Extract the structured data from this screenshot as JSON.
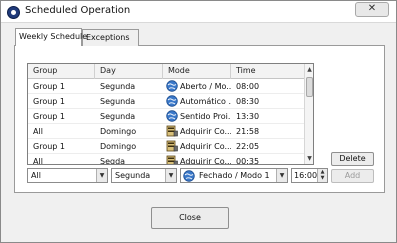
{
  "window": {
    "title": "Scheduled Operation",
    "close_glyph": "✕"
  },
  "tabs": [
    {
      "label": "Weekly Schedule",
      "active": true
    },
    {
      "label": "Exceptions",
      "active": false
    }
  ],
  "grid": {
    "columns": [
      "Group",
      "Day",
      "Mode",
      "Time"
    ],
    "rows": [
      {
        "group": "Group 1",
        "day": "Segunda",
        "mode": "Aberto / Mo...",
        "time": "08:00",
        "icon": "globe-icon"
      },
      {
        "group": "Group 1",
        "day": "Segunda",
        "mode": "Automático ...",
        "time": "08:30",
        "icon": "globe-icon"
      },
      {
        "group": "Group 1",
        "day": "Segunda",
        "mode": "Sentido Proi...",
        "time": "13:30",
        "icon": "globe-icon"
      },
      {
        "group": "All",
        "day": "Domingo",
        "mode": "Adquirir Co...",
        "time": "21:58",
        "icon": "server-icon"
      },
      {
        "group": "Group 1",
        "day": "Domingo",
        "mode": "Adquirir Co...",
        "time": "22:05",
        "icon": "server-icon"
      },
      {
        "group": "All",
        "day": "Segda",
        "mode": "Adquirir Co...",
        "time": "00:35",
        "icon": "server-icon"
      }
    ]
  },
  "editor": {
    "group_value": "All",
    "day_value": "Segunda",
    "mode_value": "Fechado / Modo 1",
    "time_value": "16:00"
  },
  "buttons": {
    "delete": "Delete",
    "add": "Add",
    "close": "Close"
  },
  "colors": {
    "globe": "#3a78c9",
    "server": "#8a6a2a"
  }
}
